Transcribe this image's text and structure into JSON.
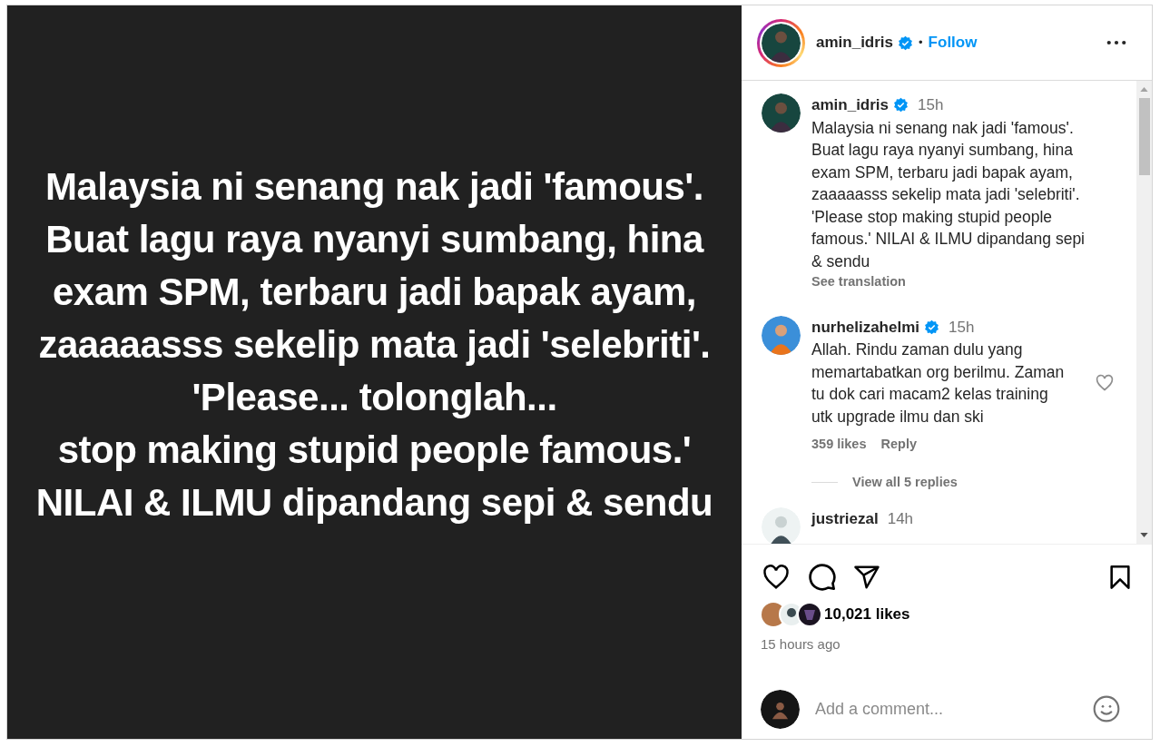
{
  "post_image": {
    "lines": [
      "Malaysia ni senang nak jadi 'famous'.",
      "Buat lagu raya nyanyi sumbang, hina",
      "exam SPM, terbaru jadi bapak ayam,",
      "zaaaaasss sekelip mata jadi 'selebriti'.",
      "'Please... tolonglah...",
      "stop making stupid people famous.'",
      "NILAI & ILMU dipandang sepi & sendu"
    ]
  },
  "header": {
    "username": "amin_idris",
    "verified": true,
    "separator": "•",
    "follow": "Follow"
  },
  "caption": {
    "username": "amin_idris",
    "verified": true,
    "time": "15h",
    "text": "Malaysia ni senang nak jadi 'famous'. Buat lagu raya nyanyi sumbang, hina exam SPM, terbaru jadi bapak ayam, zaaaaasss sekelip mata jadi 'selebriti'. 'Please stop making stupid people famous.' NILAI & ILMU dipandang sepi & sendu",
    "see_translation": "See translation"
  },
  "comments": [
    {
      "username": "nurhelizahelmi",
      "verified": true,
      "time": "15h",
      "text": "Allah. Rindu zaman dulu yang memartabatkan org berilmu. Zaman tu dok cari macam2 kelas training utk upgrade ilmu dan ski",
      "likes": "359 likes",
      "reply": "Reply",
      "view_replies": "View all 5 replies"
    },
    {
      "username": "justriezal",
      "time": "14h"
    }
  ],
  "likes": "10,021 likes",
  "posted": "15 hours ago",
  "comment_box": {
    "placeholder": "Add a comment..."
  }
}
